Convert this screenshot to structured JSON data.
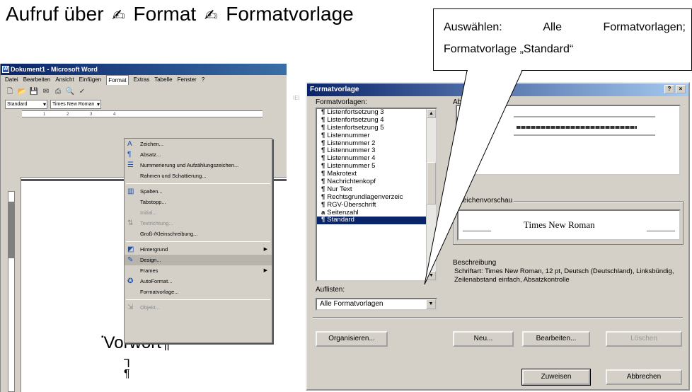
{
  "headline": {
    "part1": "Aufruf über",
    "part2": "Format",
    "part3": "Formatvorlage",
    "pen_glyph": "✍"
  },
  "word": {
    "title": "Dokument1 - Microsoft Word",
    "menubar": [
      "Datei",
      "Bearbeiten",
      "Ansicht",
      "Einfügen",
      "Format",
      "Extras",
      "Tabelle",
      "Fenster",
      "?"
    ],
    "style_combo": "Standard",
    "font_combo": "Times New Roman",
    "format_menu": [
      {
        "label": "Zeichen...",
        "icon": "A",
        "state": "normal"
      },
      {
        "label": "Absatz...",
        "icon": "¶",
        "state": "normal"
      },
      {
        "label": "Nummerierung und Aufzählungszeichen...",
        "icon": "☰",
        "state": "normal"
      },
      {
        "label": "Rahmen und Schattierung...",
        "icon": "",
        "state": "normal"
      },
      {
        "sep": true
      },
      {
        "label": "Spalten...",
        "icon": "▥",
        "state": "normal"
      },
      {
        "label": "Tabstopp...",
        "icon": "",
        "state": "normal"
      },
      {
        "label": "Initial...",
        "icon": "",
        "state": "disabled"
      },
      {
        "label": "Textrichtung...",
        "icon": "⇅",
        "state": "disabled"
      },
      {
        "label": "Groß-/Kleinschreibung...",
        "icon": "",
        "state": "normal"
      },
      {
        "sep": true
      },
      {
        "label": "Hintergrund",
        "icon": "◩",
        "state": "normal",
        "submenu": true
      },
      {
        "label": "Design...",
        "icon": "✎",
        "state": "highlight"
      },
      {
        "label": "Frames",
        "icon": "",
        "state": "normal",
        "submenu": true
      },
      {
        "label": "AutoFormat...",
        "icon": "✪",
        "state": "normal"
      },
      {
        "label": "Formatvorlage...",
        "icon": "",
        "state": "normal"
      },
      {
        "sep": true
      },
      {
        "label": "Objekt...",
        "icon": "⇲",
        "state": "disabled"
      }
    ],
    "pilcrow": "¶",
    "heading": "Vorwort¶"
  },
  "dialog": {
    "title": "Formatvorlage",
    "help_button": "?",
    "close_button": "×",
    "list_label": "Formatvorlagen:",
    "styles": [
      "Listenfortsetzung 3",
      "Listenfortsetzung 4",
      "Listenfortsetzung 5",
      "Listennummer",
      "Listennummer 2",
      "Listennummer 3",
      "Listennummer 4",
      "Listennummer 5",
      "Makrotext",
      "Nachrichtenkopf",
      "Nur Text",
      "Rechtsgrundlagenverzeic",
      "RGV-Überschrift",
      "Seitenzahl",
      "Standard"
    ],
    "selected_style": "Standard",
    "paragraph_preview_label": "Absatzvorschau",
    "char_preview_label": "Zeichenvorschau",
    "char_preview_text": "Times New Roman",
    "description_label": "Beschreibung",
    "description_text": "Schriftart: Times New Roman, 12 pt, Deutsch (Deutschland), Linksbündig, Zeilenabstand einfach, Absatzkontrolle",
    "list_filter_label": "Auflisten:",
    "list_filter_value": "Alle Formatvorlagen",
    "buttons": {
      "organize": "Organisieren...",
      "new": "Neu...",
      "edit": "Bearbeiten...",
      "delete": "Löschen",
      "apply": "Zuweisen",
      "cancel": "Abbrechen"
    }
  },
  "callout": {
    "line1": "Auswählen: Alle Formatvorlagen;",
    "line2": "Formatvorlage „Standard“"
  },
  "colors": {
    "titlebar": "#0a246a",
    "selection": "#0a246a",
    "window_face": "#d4d0c8"
  }
}
